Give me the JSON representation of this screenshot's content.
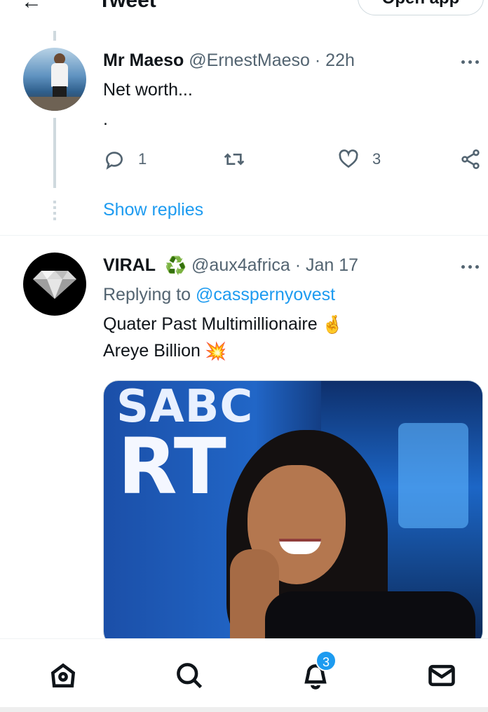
{
  "header": {
    "back_icon": "arrow-left-icon",
    "title": "Tweet",
    "open_app_label": "Open app"
  },
  "tweets": [
    {
      "name": "Mr Maeso",
      "handle": "@ErnestMaeso",
      "separator": "·",
      "time": "22h",
      "text_lines": [
        "Net worth...",
        "."
      ],
      "actions": {
        "reply_count": "1",
        "retweet_count": "",
        "like_count": "3"
      },
      "show_replies_label": "Show replies"
    },
    {
      "name": "VIRAL",
      "name_emoji": "♻️",
      "handle": "@aux4africa",
      "separator": "·",
      "time": "Jan 17",
      "replying_prefix": "Replying to",
      "replying_handle": "@casspernyovest",
      "text_lines": [
        "Quater Past Multimillionaire",
        "Areye Billion"
      ],
      "text_emojis": [
        "🤞",
        "💥"
      ],
      "media": {
        "logo_top": "SABC",
        "logo_bottom": "RT"
      }
    }
  ],
  "bottom_nav": {
    "items": [
      "home-icon",
      "search-icon",
      "notifications-icon",
      "messages-icon"
    ],
    "notification_badge": "3"
  },
  "colors": {
    "accent": "#1d9bf0",
    "text_primary": "#0f1419",
    "text_secondary": "#536471",
    "border": "#cfd9de"
  }
}
